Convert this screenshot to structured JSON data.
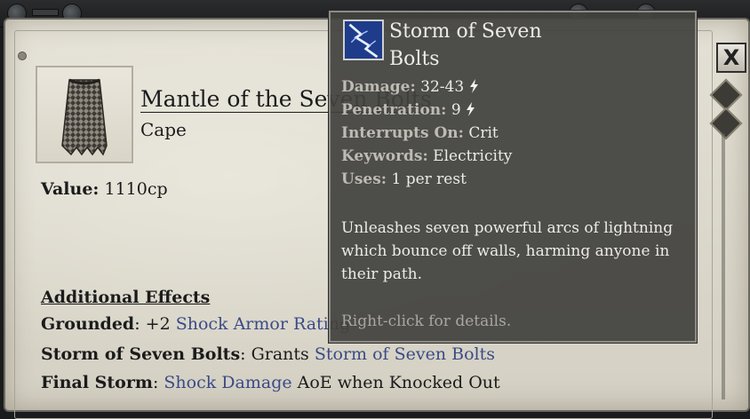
{
  "item": {
    "name": "Mantle of the Seven Bolts",
    "type": "Cape",
    "value_label": "Value:",
    "value": "1110cp"
  },
  "effects": {
    "title": "Additional Effects",
    "rows": [
      {
        "label": "Grounded",
        "sep": ": +2 ",
        "link": "Shock Armor Rating",
        "rest": ""
      },
      {
        "label": "Storm of Seven Bolts",
        "sep": ": Grants ",
        "link": "Storm of Seven Bolts",
        "rest": ""
      },
      {
        "label": "Final Storm",
        "sep": ": ",
        "link": "Shock Damage",
        "rest": " AoE when Knocked Out"
      }
    ]
  },
  "tooltip": {
    "title": "Storm of Seven Bolts",
    "icon": "lightning-ability-icon",
    "damage_label": "Damage:",
    "damage": "32-43",
    "penetration_label": "Penetration:",
    "penetration": "9",
    "interrupts_label": "Interrupts On:",
    "interrupts": "Crit",
    "keywords_label": "Keywords:",
    "keywords": "Electricity",
    "uses_label": "Uses:",
    "uses": "1 per rest",
    "description": "Unleashes seven powerful arcs of lightning which bounce off walls, harming anyone in their path.",
    "hint": "Right-click for details."
  },
  "close_button": {
    "label": "X"
  },
  "colors": {
    "link": "#3a4b86",
    "tooltip_bg": "#42423e",
    "parchment": "#dcd8cc"
  }
}
